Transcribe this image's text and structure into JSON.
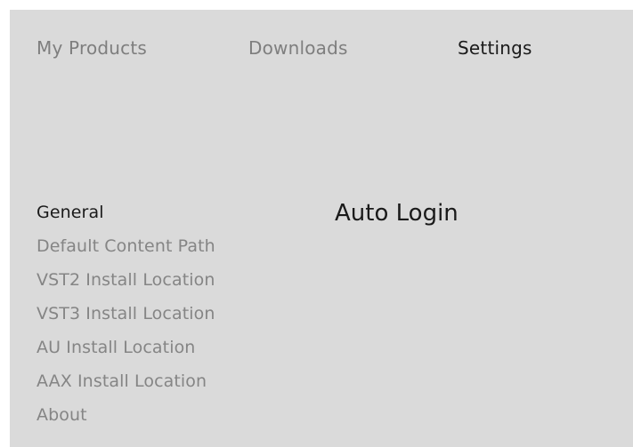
{
  "top_nav": {
    "tabs": [
      {
        "label": "My Products",
        "active": false
      },
      {
        "label": "Downloads",
        "active": false
      },
      {
        "label": "Settings",
        "active": true
      }
    ]
  },
  "sidebar": {
    "items": [
      {
        "label": "General",
        "active": true
      },
      {
        "label": "Default Content Path",
        "active": false
      },
      {
        "label": "VST2 Install Location",
        "active": false
      },
      {
        "label": "VST3 Install Location",
        "active": false
      },
      {
        "label": "AU Install Location",
        "active": false
      },
      {
        "label": "AAX Install Location",
        "active": false
      },
      {
        "label": "About",
        "active": false
      }
    ]
  },
  "main": {
    "section_title": "Auto Login"
  },
  "colors": {
    "background": "#dadada",
    "active_text": "#1a1a1a",
    "inactive_text": "#858585"
  }
}
